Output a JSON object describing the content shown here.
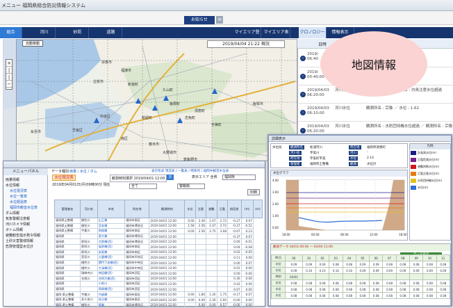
{
  "app": {
    "title": "メニュー 福岡県総合防災情報システム",
    "notice_label": "お知らせ",
    "notice_icon": "mail-icon"
  },
  "tabs": [
    {
      "label": "総合",
      "active": true
    },
    {
      "label": "河川"
    },
    {
      "label": "砂防"
    },
    {
      "label": "道路"
    },
    {
      "label": "マイエリア登録"
    },
    {
      "label": "マイエリア表示"
    },
    {
      "label": "クロノロジー"
    },
    {
      "label": "情報表示"
    }
  ],
  "map": {
    "auto_button": "自動移動",
    "timestamp": "2019/04/04 21:22 現況",
    "place_labels": [
      "宗像市",
      "福津市",
      "古賀市",
      "新宮町",
      "久山町",
      "篠栗町",
      "中央区",
      "早良区",
      "南区",
      "糸島市",
      "春日市",
      "大野城市",
      "宇美町",
      "志免町",
      "須恵町",
      "飯塚市",
      "筑紫野市",
      "粕屋町"
    ]
  },
  "chronology": {
    "header": "日時",
    "rows": [
      {
        "date": "2019/",
        "time": "06:40",
        "river": "",
        "detail": ""
      },
      {
        "date": "2019/",
        "time": "00:40:00",
        "river": "",
        "detail": ""
      },
      {
        "date": "2019/04/03",
        "time": "06:20:00",
        "river": "河川水位",
        "detail": "水位 : 2.03 ／ 観測所名 : 白鳥注意水位超過"
      },
      {
        "date": "2019/04/03",
        "time": "06:10:00",
        "river": "河川水位",
        "detail": "観測所名 : 宗像 ／ 水位 : 1.62"
      },
      {
        "date": "2019/04/03",
        "time": "06:20:00",
        "river": "河川水位",
        "detail": "観測所名 : 水防団待機水位超過 ／ 観測所名 : 宗像"
      }
    ]
  },
  "callout": {
    "label": "地図情報"
  },
  "menu_panel": {
    "title": "メニューパネル",
    "items": [
      {
        "label": "雨量情報",
        "sub": false
      },
      {
        "label": "水位情報",
        "sub": false
      },
      {
        "label": "水位現況表",
        "sub": true
      },
      {
        "label": "水位一覧表",
        "sub": true
      },
      {
        "label": "水位経過表",
        "sub": true
      },
      {
        "label": "福岡市観音水位表",
        "sub": true
      },
      {
        "label": "ダム情報",
        "sub": false
      },
      {
        "label": "気象警報注意報",
        "sub": false
      },
      {
        "label": "河川カメラ情報",
        "sub": false
      },
      {
        "label": "ボトム情報",
        "sub": false
      },
      {
        "label": "避難勧告指示発令情報",
        "sub": false
      },
      {
        "label": "土砂災害警戒情報",
        "sub": false
      },
      {
        "label": "危険管理型水位計",
        "sub": false
      }
    ]
  },
  "water_table": {
    "title": "水位現況表",
    "toolbar": {
      "data_type": "データ種別",
      "links": "雨量 / 水位 / ダム",
      "display_links": "表示形式 現況表 / 一覧表 / 時系列 / 福岡中観音水位表",
      "observed_label": "観測時刻選択 2019/04/01 12:00",
      "prev": "前",
      "next": "次",
      "select_label": "表示エリア 全県",
      "area_select": "福岡県",
      "river_select": "全て",
      "water_select": "警報順",
      "print_label": "印刷"
    },
    "date_line": "2019年04月01日(月)09時00分 現在",
    "headers": [
      "管理者名",
      "河川名",
      "市名",
      "所在地",
      "観測時刻",
      "水位",
      "注意",
      "避難",
      "氾濫",
      "前回差",
      "(m)",
      "(m)"
    ],
    "rows": [
      [
        "福岡県土整備",
        "御笠川",
        "山王橋",
        "福岡市東区",
        "2019 04/01 12:00",
        "0.00",
        "2.40",
        "2.47",
        "2.72",
        "-0.27",
        "0.07"
      ],
      [
        "福岡県土整備",
        "御笠川",
        "宮本橋",
        "福岡市博多区",
        "2019 04/01 12:00",
        "1.58",
        "2.56",
        "2.47",
        "2.72",
        "-0.27",
        "-0.51"
      ],
      [
        "福岡県土整備",
        "宇美川",
        "南畑橋",
        "福岡市南区",
        "2019 04/01 12:00",
        "0.00",
        "2.56",
        "2.75",
        "3.08",
        "-0.07",
        "0.23"
      ],
      [
        "福岡県",
        "",
        "東大橋",
        "福岡市博多区",
        "2019 04/01 12:00",
        "",
        "",
        "",
        "",
        "-0.37",
        "0.07"
      ],
      [
        "福岡県",
        "那珂川",
        "大野橋(西)",
        "福岡市博多区",
        "2019 04/01 12:00",
        "",
        "",
        "",
        "",
        "0.00",
        "-0.01"
      ],
      [
        "福岡県",
        "那珂川",
        "塩原橋(西)",
        "福岡市南区",
        "2019 04/01 12:00",
        "",
        "",
        "",
        "",
        "0.04",
        "-0.08"
      ],
      [
        "福岡県",
        "那珂川",
        "安東橋",
        "福岡市南区",
        "2019 04/01 12:00",
        "",
        "",
        "",
        "",
        "0.02",
        "-0.05"
      ],
      [
        "福岡県",
        "室見川",
        "九重橋(西)",
        "福岡市早良区",
        "2019 04/01 12:00",
        "",
        "",
        "",
        "",
        "0.11",
        "0.00"
      ],
      [
        "福岡県",
        "樋井川",
        "関門下流橋(西)",
        "福岡市中央区",
        "2019 04/01 12:00",
        "",
        "",
        "",
        "",
        "0.00",
        "0.07"
      ],
      [
        "福岡県",
        "樋井川",
        "大濠橋(西)",
        "福岡市中央区",
        "2019 04/01 12:00",
        "",
        "",
        "",
        "",
        "0.01",
        "0.00"
      ],
      [
        "福岡県",
        "瑞梅寺川",
        "神田橋(西)",
        "福岡市西区",
        "2019 04/01 12:00",
        "",
        "",
        "",
        "",
        "0.00",
        "-0.00"
      ],
      [
        "福岡県",
        "名柄川",
        "名柄大橋(西)",
        "福岡市西区",
        "2019 04/01 12:00",
        "",
        "",
        "",
        "",
        "0.30",
        "0.00"
      ],
      [
        "福岡県",
        "",
        "十郎川",
        "福岡市西区",
        "2019 04/01 12:00",
        "",
        "",
        "",
        "",
        "0.42",
        "0.00"
      ],
      [
        "福岡県",
        "",
        "青柳橋(西)",
        "福岡市西区",
        "2019 04/01 12:00",
        "",
        "",
        "",
        "",
        "0.07",
        "0.00"
      ],
      [
        "福岡 県土整備",
        "宇美川",
        "竹越橋",
        "福岡市東区",
        "2019 04/01 12:00",
        "0.00",
        "1.80",
        "1.20",
        "1.75",
        "-0.17",
        "0.07"
      ],
      [
        "福岡 県土整備",
        "多々良川",
        "長谷橋",
        "福岡市東区",
        "2019 04/01 12:00",
        "0.00",
        "0.00",
        "2.30",
        "2.00",
        "-0.00",
        "0.00"
      ],
      [
        "福岡 県土整備",
        "御笠川",
        "堀端",
        "福岡市博多区",
        "2019 04/01 12:00",
        "",
        "0.00",
        "0.00",
        "0.57",
        "-0.00",
        "0.00"
      ]
    ]
  },
  "detail_panel": {
    "header": "詳細表示",
    "info_rows": [
      [
        "水位局",
        "観測所名",
        "松浦河川",
        "所在地",
        "福岡県須恵町"
      ],
      [
        "",
        "河川名",
        "宇美川",
        "河川",
        "-"
      ],
      [
        "",
        "所在地",
        "宇美町宇美",
        "水位",
        "2.14"
      ],
      [
        "",
        "管理者",
        "福岡県土整備",
        "観測",
        "水位計"
      ]
    ],
    "graph_title": "水位グラフ",
    "graph_times": [
      "18:00",
      "00:00",
      "06:00",
      "12:00",
      "18:00"
    ],
    "graph_y": [
      "4.00",
      "3.00",
      "2.00",
      "1.00",
      "0.00"
    ],
    "legend_title": "凡例",
    "legend": [
      {
        "label": "計画高水位(m)",
        "color": "#1b1b8a"
      },
      {
        "label": "氾濫危険水位(m)",
        "color": "#7a1f8a"
      },
      {
        "label": "避難判断水位(m)",
        "color": "#d11a1a"
      },
      {
        "label": "氾濫注意水位(m)",
        "color": "#e87b10"
      },
      {
        "label": "水防団待機水位(m)",
        "color": "#e0c21a"
      },
      {
        "label": "水位(m)",
        "color": "#2c6fd8"
      }
    ],
    "rdata_title": "観測データ 04/03 00:00 ～ 04/04 11:00",
    "rdata_link": "データ表示",
    "rdata_rows": [
      [
        "時/日",
        "00",
        "01",
        "02",
        "03",
        "04",
        "05",
        "06",
        "07",
        "08",
        "09",
        "10",
        "11"
      ],
      [
        "水位",
        "0.09",
        "0.09",
        "0.09",
        "0.08",
        "0.08",
        "0.09",
        "0.09",
        "0.08",
        "0.08",
        "0.08",
        "0.08",
        "0.08"
      ],
      [
        "水位",
        "0.09",
        "0.10",
        "0.10",
        "0.10",
        "0.10",
        "0.09",
        "0.09",
        "0.09",
        "0.09",
        "0.09",
        "0.09",
        "0.09"
      ],
      [
        "時刻",
        "04/03",
        "",
        "",
        "",
        "",
        "",
        "",
        "",
        "",
        "",
        "",
        ""
      ],
      [
        "水位",
        "0.08",
        "0.08",
        "0.08",
        "0.08",
        "0.08",
        "0.08",
        "0.08",
        "0.08",
        "0.08",
        "0.08",
        "0.08",
        "0.08"
      ],
      [
        "水位",
        "0.08",
        "0.08",
        "0.08",
        "0.08",
        "0.08",
        "0.08",
        "0.08",
        "0.08",
        "0.08",
        "0.08",
        "0.08",
        "0.08"
      ],
      [
        "水位",
        "0.08",
        "0.08",
        "0.08",
        "0.08",
        "0.08",
        "0.08",
        "0.08",
        "0.08",
        "0.08",
        "0.08",
        "0.08",
        "0.08"
      ]
    ]
  }
}
